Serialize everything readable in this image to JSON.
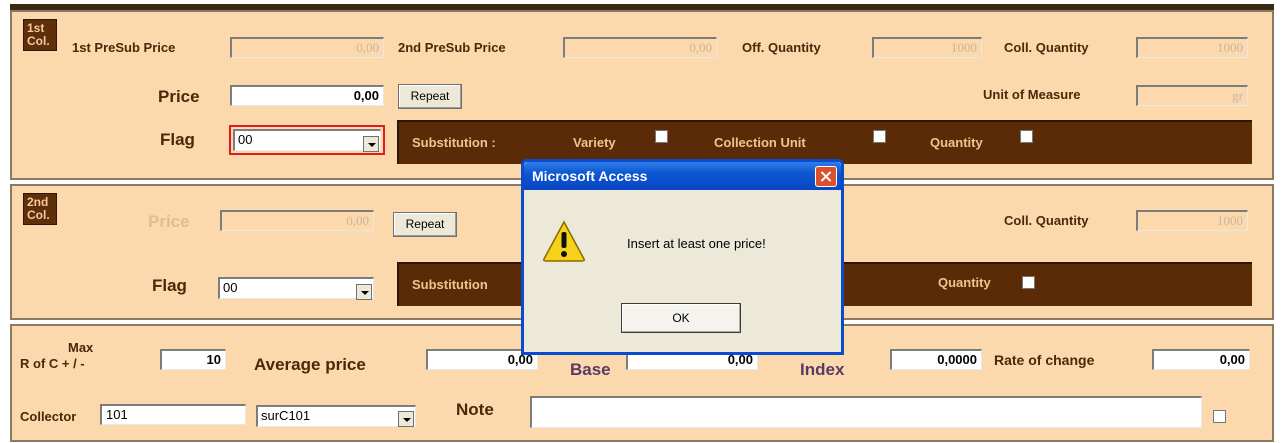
{
  "section1": {
    "badge_line1": "1st",
    "badge_line2": "Col.",
    "presub1_label": "1st PreSub  Price",
    "presub1_value": "0,00",
    "presub2_label": "2nd PreSub Price",
    "presub2_value": "0,00",
    "off_qty_label": "Off. Quantity",
    "off_qty_value": "1000",
    "coll_qty_label": "Coll. Quantity",
    "coll_qty_value": "1000",
    "price_label": "Price",
    "price_value": "0,00",
    "repeat_label": "Repeat",
    "uom_label": "Unit of Measure",
    "uom_value": "gr",
    "flag_label": "Flag",
    "flag_value": "00",
    "substitution_label": "Substitution :",
    "variety_label": "Variety",
    "collection_unit_label": "Collection Unit",
    "quantity_label": "Quantity"
  },
  "section2": {
    "badge_line1": "2nd",
    "badge_line2": "Col.",
    "price_label": "Price",
    "price_value": "0,00",
    "repeat_label": "Repeat",
    "coll_qty_label": "Coll. Quantity",
    "coll_qty_value": "1000",
    "flag_label": "Flag",
    "flag_value": "00",
    "substitution_label": "Substitution",
    "quantity_label": "Quantity"
  },
  "section3": {
    "max_label_line1": "Max",
    "max_label_line2": "R of C + / -",
    "max_value": "10",
    "avg_label": "Average price",
    "avg_value": "0,00",
    "base_label": "Base",
    "base_value": "0,00",
    "index_label": "Index",
    "index_value": "0,0000",
    "rate_label": "Rate of change",
    "rate_value": "0,00",
    "collector_label": "Collector",
    "collector_value": "101",
    "collector_combo_value": "surC101",
    "note_label": "Note",
    "note_value": ""
  },
  "dialog": {
    "title": "Microsoft Access",
    "message": "Insert at least one price!",
    "ok_label": "OK",
    "icon": "warning-icon"
  },
  "colors": {
    "panel_bg": "#fbd9ad",
    "dark_brown": "#5b2b08",
    "label_brown": "#4a2808",
    "xp_blue": "#0a4ccf",
    "flag_highlight": "#e11c1c"
  }
}
